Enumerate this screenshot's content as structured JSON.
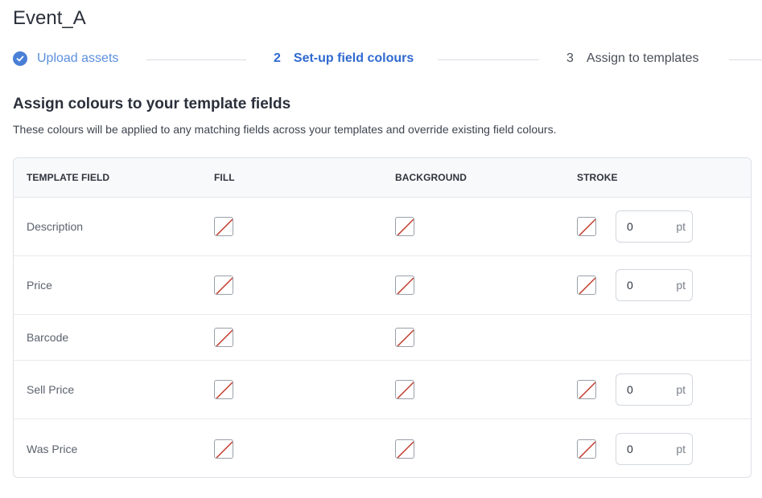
{
  "title": "Event_A",
  "stepper": {
    "steps": [
      {
        "number": "",
        "label": "Upload assets",
        "status": "complete"
      },
      {
        "number": "2",
        "label": "Set-up field colours",
        "status": "active"
      },
      {
        "number": "3",
        "label": "Assign to templates",
        "status": "upcoming"
      }
    ]
  },
  "section": {
    "title": "Assign colours to your template fields",
    "description": "These colours will be applied to any matching fields across your templates and override existing field colours."
  },
  "table": {
    "headers": [
      "TEMPLATE FIELD",
      "FILL",
      "BACKGROUND",
      "STROKE"
    ],
    "rows": [
      {
        "field": "Description",
        "fill": "none",
        "background": "none",
        "stroke": "none",
        "stroke_width": "0",
        "unit": "pt"
      },
      {
        "field": "Price",
        "fill": "none",
        "background": "none",
        "stroke": "none",
        "stroke_width": "0",
        "unit": "pt"
      },
      {
        "field": "Barcode",
        "fill": "none",
        "background": "none"
      },
      {
        "field": "Sell Price",
        "fill": "none",
        "background": "none",
        "stroke": "none",
        "stroke_width": "0",
        "unit": "pt"
      },
      {
        "field": "Was Price",
        "fill": "none",
        "background": "none",
        "stroke": "none",
        "stroke_width": "0",
        "unit": "pt"
      }
    ]
  },
  "colors": {
    "accent": "#2f6ad0",
    "complete": "#5b8fdd",
    "no_color_slash": "#c0392b"
  }
}
